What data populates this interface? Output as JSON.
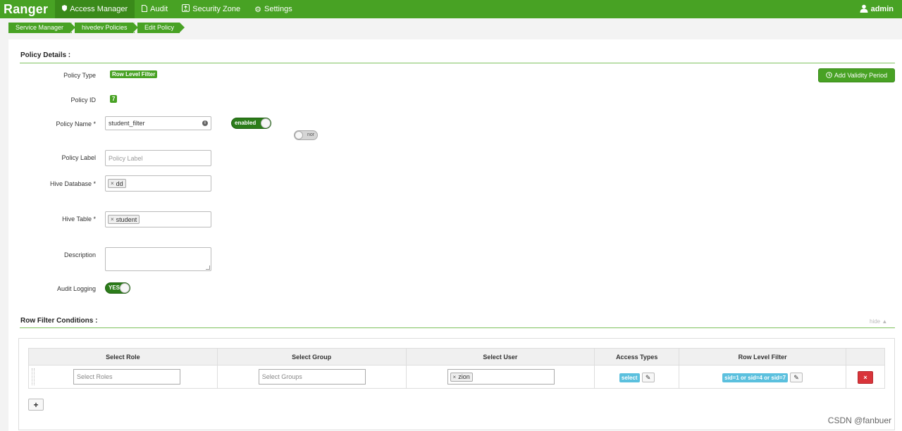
{
  "app": {
    "brand": "Ranger"
  },
  "nav": {
    "items": [
      {
        "label": "Access Manager",
        "icon": "shield-icon",
        "active": true
      },
      {
        "label": "Audit",
        "icon": "file-icon",
        "active": false
      },
      {
        "label": "Security Zone",
        "icon": "zone-icon",
        "active": false
      },
      {
        "label": "Settings",
        "icon": "gear-icon",
        "active": false
      }
    ],
    "user": "admin"
  },
  "breadcrumb": [
    "Service Manager",
    "hivedev Policies",
    "Edit Policy"
  ],
  "policy_details": {
    "title": "Policy Details :",
    "type_label": "Policy Type",
    "type_value": "Row Level Filter",
    "id_label": "Policy ID",
    "id_value": "7",
    "name_label": "Policy Name *",
    "name_value": "student_filter",
    "enabled_toggle": "enabled",
    "override_toggle": "nor",
    "add_validity": "Add Validity Period",
    "label_label": "Policy Label",
    "label_placeholder": "Policy Label",
    "db_label": "Hive Database *",
    "db_tag": "dd",
    "table_label": "Hive Table *",
    "table_tag": "student",
    "desc_label": "Description",
    "audit_label": "Audit Logging",
    "audit_value": "YES"
  },
  "row_filter": {
    "title": "Row Filter Conditions :",
    "hide_link": "hide ▲",
    "headers": [
      "Select Role",
      "Select Group",
      "Select User",
      "Access Types",
      "Row Level Filter",
      ""
    ],
    "role_placeholder": "Select Roles",
    "group_placeholder": "Select Groups",
    "user_tag": "zion",
    "access_type": "select",
    "filter_expr": "sid=1 or sid=4 or sid=7",
    "delete": "×",
    "add": "+"
  },
  "watermark": "CSDN @fanbuer",
  "colors": {
    "brand_green": "#48a224",
    "danger": "#d9343a",
    "info": "#5bc0de"
  }
}
